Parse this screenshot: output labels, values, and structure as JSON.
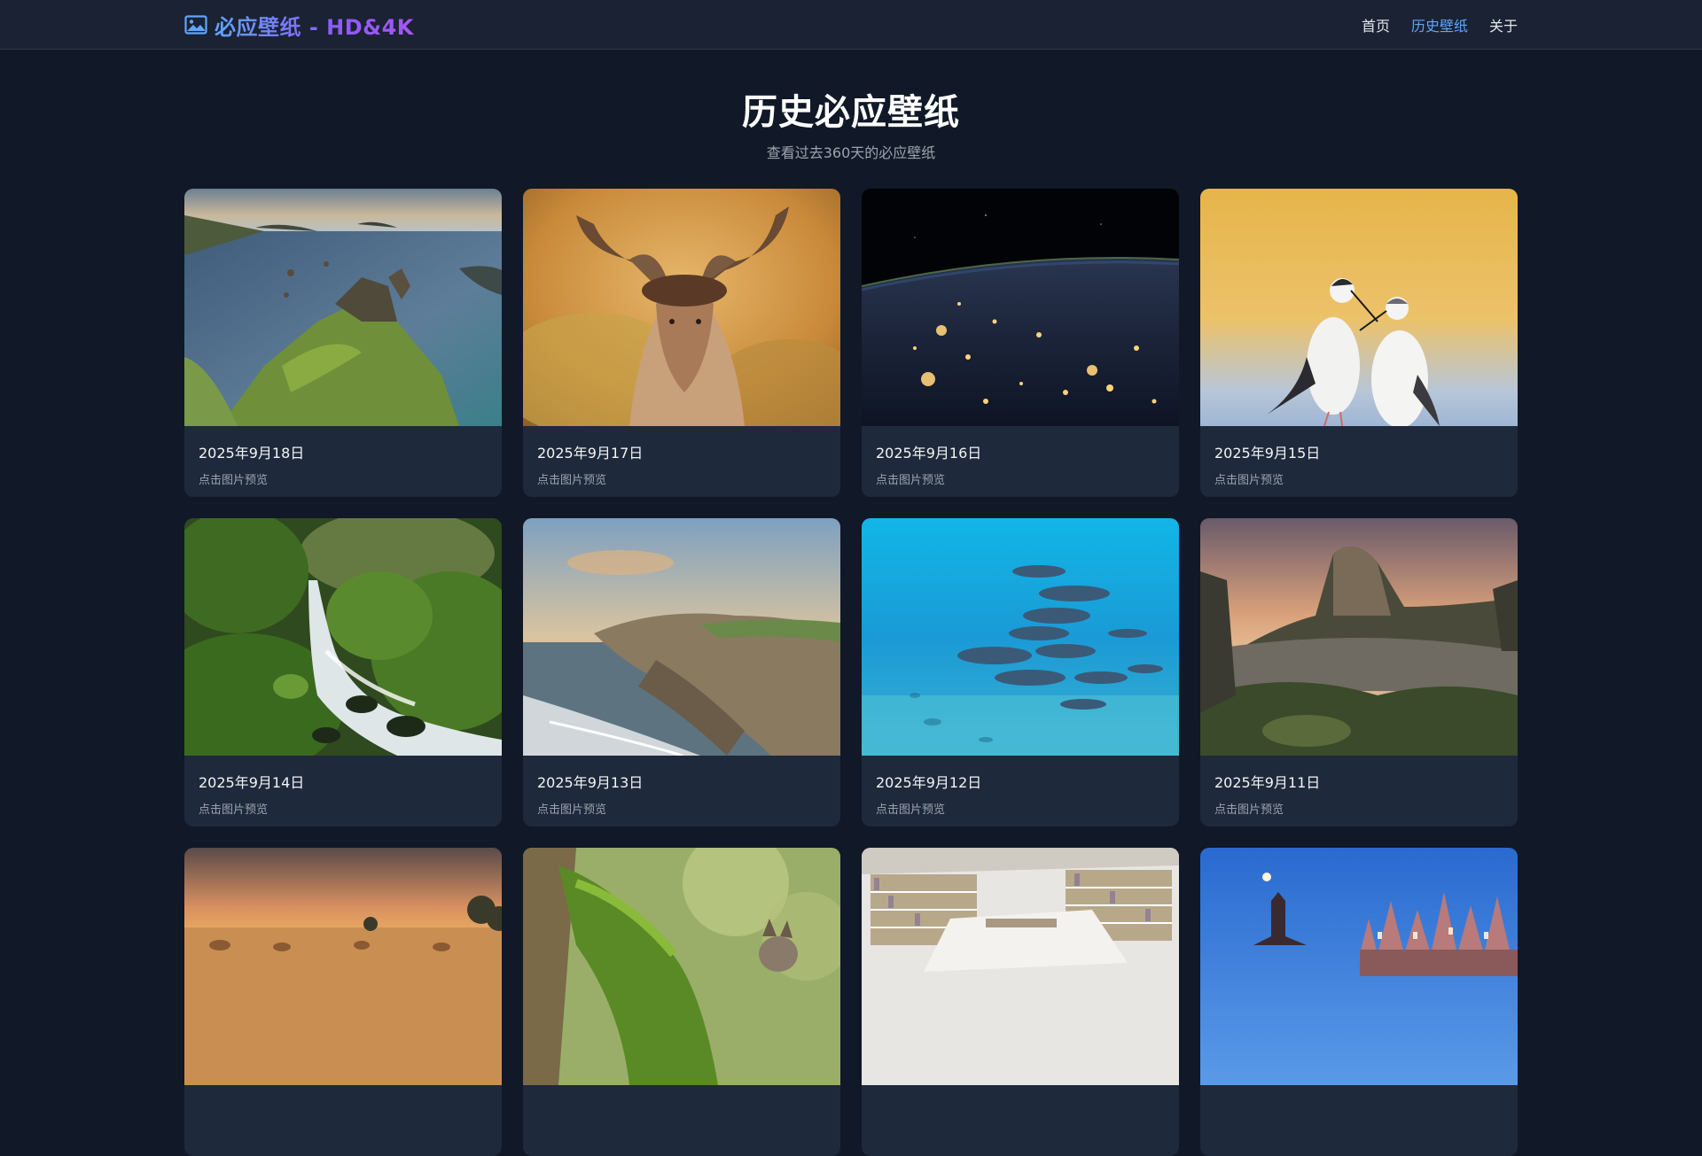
{
  "header": {
    "brand_icon": "image-icon",
    "brand_text": "必应壁纸 - HD&4K",
    "nav": [
      {
        "label": "首页",
        "active": false
      },
      {
        "label": "历史壁纸",
        "active": true
      },
      {
        "label": "关于",
        "active": false
      }
    ]
  },
  "page": {
    "title": "历史必应壁纸",
    "subtitle": "查看过去360天的必应壁纸"
  },
  "wallpapers": [
    {
      "date": "2025年9月18日",
      "hint": "点击图片预览",
      "scene": "coastal-cliffs"
    },
    {
      "date": "2025年9月17日",
      "hint": "点击图片预览",
      "scene": "young-moose"
    },
    {
      "date": "2025年9月16日",
      "hint": "点击图片预览",
      "scene": "earth-night-lights"
    },
    {
      "date": "2025年9月15日",
      "hint": "点击图片预览",
      "scene": "stilt-birds"
    },
    {
      "date": "2025年9月14日",
      "hint": "点击图片预览",
      "scene": "forest-waterfall"
    },
    {
      "date": "2025年9月13日",
      "hint": "点击图片预览",
      "scene": "sea-cliffs-sunset"
    },
    {
      "date": "2025年9月12日",
      "hint": "点击图片预览",
      "scene": "dolphins-underwater"
    },
    {
      "date": "2025年9月11日",
      "hint": "点击图片预览",
      "scene": "river-rock-mountain"
    },
    {
      "date": "",
      "hint": "",
      "scene": "hay-bales-field"
    },
    {
      "date": "",
      "hint": "",
      "scene": "squirrel-mossy-branch"
    },
    {
      "date": "",
      "hint": "",
      "scene": "library-bookshelves"
    },
    {
      "date": "",
      "hint": "",
      "scene": "old-town-moon"
    }
  ],
  "colors": {
    "background": "#111827",
    "header": "#1a2233",
    "card": "#1e293b",
    "accent": "#60a5fa",
    "brand_gradient_end": "#a855f7"
  }
}
